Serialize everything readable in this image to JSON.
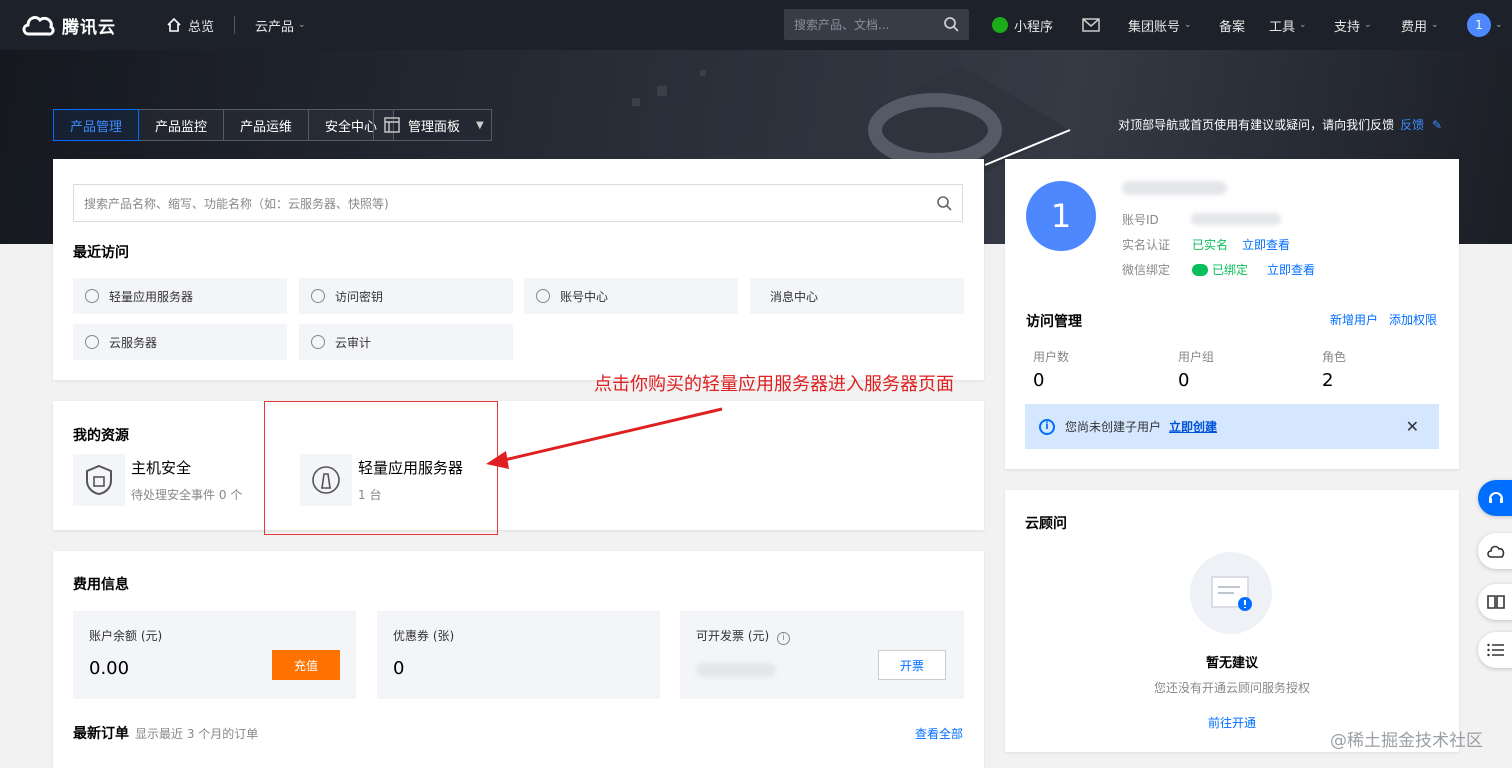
{
  "topnav": {
    "brand": "腾讯云",
    "overview": "总览",
    "products": "云产品",
    "search_placeholder": "搜索产品、文档...",
    "miniprogram": "小程序",
    "group_account": "集团账号",
    "filing": "备案",
    "tools": "工具",
    "support": "支持",
    "billing": "费用",
    "avatar_letter": "1"
  },
  "banner": {
    "tabs": [
      "产品管理",
      "产品监控",
      "产品运维",
      "安全中心"
    ],
    "panel_select": "管理面板",
    "feedback_text": "对顶部导航或首页使用有建议或疑问，请向我们反馈",
    "feedback_link": "反馈"
  },
  "search_card": {
    "placeholder": "搜索产品名称、缩写、功能名称（如：云服务器、快照等)",
    "recent_title": "最近访问",
    "recent": [
      "轻量应用服务器",
      "访问密钥",
      "账号中心",
      "消息中心",
      "云服务器",
      "云审计"
    ]
  },
  "resources": {
    "title": "我的资源",
    "items": [
      {
        "name": "主机安全",
        "sub": "待处理安全事件 0 个"
      },
      {
        "name": "轻量应用服务器",
        "sub": "1 台"
      }
    ]
  },
  "annotation": "点击你购买的轻量应用服务器进入服务器页面",
  "fees": {
    "title": "费用信息",
    "balance_label": "账户余额 (元)",
    "balance_value": "0.00",
    "recharge": "充值",
    "coupon_label": "优惠券 (张)",
    "coupon_value": "0",
    "invoice_label": "可开发票 (元)",
    "invoice_btn": "开票",
    "orders_title": "最新订单",
    "orders_sub": "显示最近 3 个月的订单",
    "view_all": "查看全部"
  },
  "account": {
    "avatar_letter": "1",
    "id_label": "账号ID",
    "realname_label": "实名认证",
    "realname_status": "已实名",
    "realname_link": "立即查看",
    "wechat_label": "微信绑定",
    "wechat_status": "已绑定",
    "wechat_link": "立即查看",
    "access_title": "访问管理",
    "new_user": "新增用户",
    "add_permission": "添加权限",
    "stats": [
      {
        "label": "用户数",
        "value": "0"
      },
      {
        "label": "用户组",
        "value": "0"
      },
      {
        "label": "角色",
        "value": "2"
      }
    ],
    "notice": "您尚未创建子用户",
    "notice_link": "立即创建"
  },
  "advisor": {
    "title": "云顾问",
    "empty_title": "暂无建议",
    "empty_sub": "您还没有开通云顾问服务授权",
    "link": "前往开通"
  },
  "watermark": "@稀土掘金技术社区",
  "colors": {
    "accent": "#006eff",
    "orange": "#ff7200",
    "green": "#0abf5b",
    "annot": "#e02020"
  }
}
